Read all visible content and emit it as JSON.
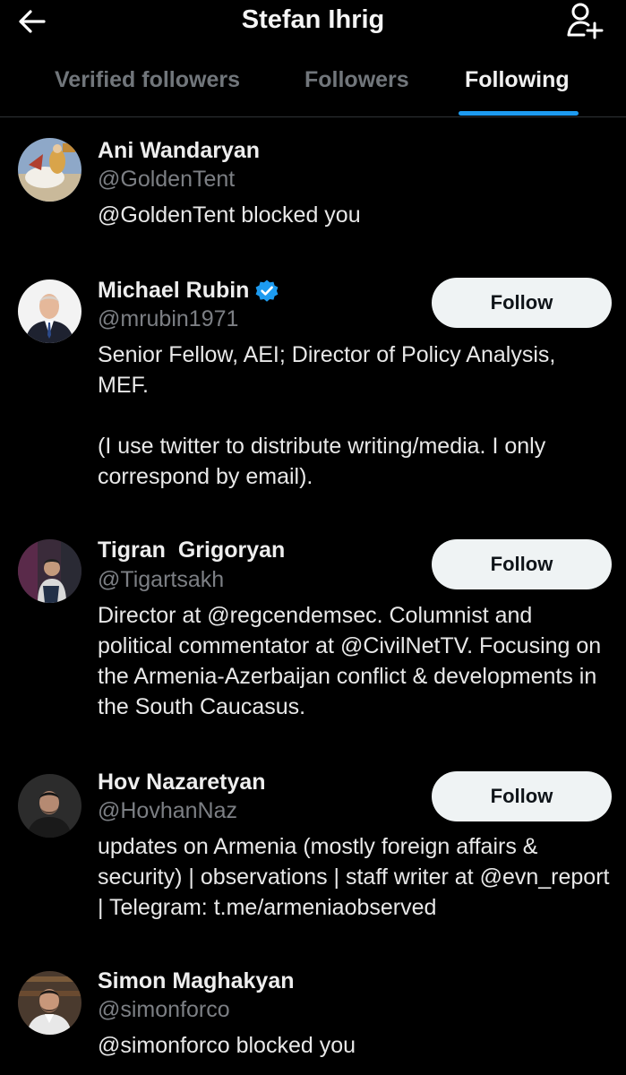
{
  "header": {
    "title": "Stefan Ihrig",
    "back_icon": "arrow-left-icon",
    "add_icon": "person-add-icon"
  },
  "tabs": [
    {
      "label": "Verified followers",
      "active": false
    },
    {
      "label": "Followers",
      "active": false
    },
    {
      "label": "Following",
      "active": true
    }
  ],
  "colors": {
    "background": "#000000",
    "accent": "#1d9bf0",
    "muted_text": "#71767b",
    "follow_button_bg": "#eff3f4"
  },
  "users": [
    {
      "name": "Ani Wandaryan",
      "handle": "@GoldenTent",
      "bio": [
        "@GoldenTent blocked you"
      ],
      "verified": false,
      "follow_label": ""
    },
    {
      "name": "Michael Rubin",
      "handle": "@mrubin1971",
      "bio": [
        "Senior Fellow, AEI; Director of Policy Analysis, MEF.",
        "(I use twitter to distribute writing/media. I only correspond by email)."
      ],
      "verified": true,
      "verified_icon": "verified-badge-icon",
      "follow_label": "Follow"
    },
    {
      "name": "Tigran  Grigoryan",
      "handle": "@Tigartsakh",
      "bio": [
        "Director at @regcendemsec. Columnist and political commentator at @CivilNetTV. Focusing on the Armenia-Azerbaijan conflict & developments in the South Caucasus."
      ],
      "verified": false,
      "follow_label": "Follow"
    },
    {
      "name": "Hov Nazaretyan",
      "handle": "@HovhanNaz",
      "bio": [
        "updates on Armenia (mostly foreign affairs & security) | observations | staff writer at @evn_report | Telegram: t.me/armeniaobserved"
      ],
      "verified": false,
      "follow_label": "Follow"
    },
    {
      "name": "Simon Maghakyan",
      "handle": "@simonforco",
      "bio": [
        "@simonforco blocked you"
      ],
      "verified": false,
      "follow_label": ""
    }
  ]
}
